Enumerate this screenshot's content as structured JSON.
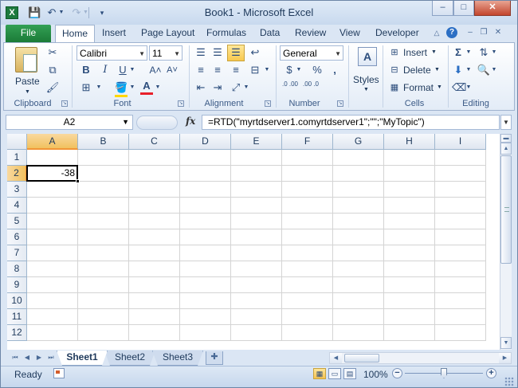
{
  "window": {
    "title": "Book1  -  Microsoft Excel",
    "app_icon_letter": "X",
    "minimize": "–",
    "maximize": "□",
    "close": "✕"
  },
  "ribbon_tabs": {
    "file": "File",
    "items": [
      "Home",
      "Insert",
      "Page Layout",
      "Formulas",
      "Data",
      "Review",
      "View",
      "Developer"
    ],
    "active": "Home"
  },
  "ribbon": {
    "clipboard": {
      "label": "Clipboard",
      "paste": "Paste"
    },
    "font": {
      "label": "Font",
      "name": "Calibri",
      "size": "11",
      "bold": "B",
      "italic": "I",
      "underline": "U",
      "grow": "A˄",
      "shrink": "A˅",
      "color_letter": "A"
    },
    "alignment": {
      "label": "Alignment"
    },
    "number": {
      "label": "Number",
      "format": "General",
      "currency": "$",
      "percent": "%",
      "comma": ",",
      "inc_dec": ".0 .00",
      "dec_dec": ".00 .0"
    },
    "styles": {
      "label": "Styles"
    },
    "cells": {
      "label": "Cells",
      "insert": "Insert",
      "delete": "Delete",
      "format": "Format"
    },
    "editing": {
      "label": "Editing",
      "sum": "Σ"
    }
  },
  "formula_bar": {
    "name_box": "A2",
    "fx": "fx",
    "formula": "=RTD(\"myrtdserver1.comyrtdserver1\";\"\";\"MyTopic\")"
  },
  "grid": {
    "columns": [
      "A",
      "B",
      "C",
      "D",
      "E",
      "F",
      "G",
      "H",
      "I"
    ],
    "rows": [
      "1",
      "2",
      "3",
      "4",
      "5",
      "6",
      "7",
      "8",
      "9",
      "10",
      "11",
      "12"
    ],
    "selected_column": "A",
    "selected_row": "2",
    "cells": {
      "A2": "-38"
    }
  },
  "sheets": {
    "tabs": [
      "Sheet1",
      "Sheet2",
      "Sheet3"
    ],
    "active": "Sheet1"
  },
  "status": {
    "mode": "Ready",
    "zoom": "100%"
  },
  "colors": {
    "file_tab": "#1b7b37",
    "selection_header": "#f1c15f",
    "chrome": "#dbe6f4"
  }
}
